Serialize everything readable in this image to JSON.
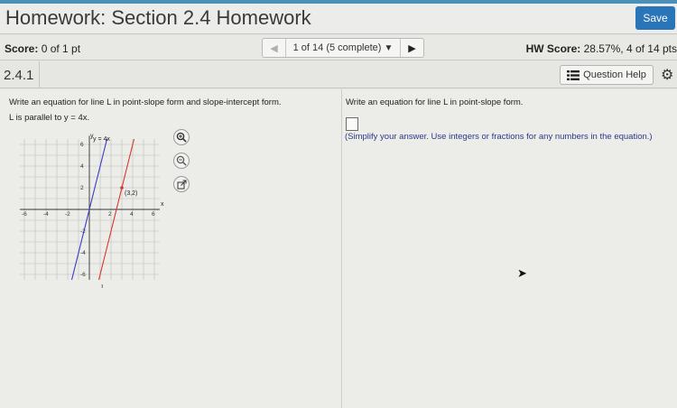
{
  "header": {
    "title": "Homework: Section 2.4 Homework",
    "save_label": "Save"
  },
  "score_bar": {
    "score_label": "Score:",
    "score_value": "0 of 1 pt",
    "nav_text": "1 of 14 (5 complete)",
    "hw_score_label": "HW Score:",
    "hw_score_value": "28.57%, 4 of 14 pts"
  },
  "question_bar": {
    "number": "2.4.1",
    "help_label": "Question Help"
  },
  "question": {
    "prompt": "Write an equation for line L in point-slope form and slope-intercept form.",
    "given": "L is parallel to y = 4x.",
    "graph": {
      "blue_line_label": "y = 4x",
      "point_label": "(3,2)",
      "line_label": "L",
      "x_axis_label": "x",
      "y_axis_label": "y",
      "x_tick_labels": [
        "-6",
        "-4",
        "-2",
        "2",
        "4",
        "6"
      ],
      "y_tick_labels": [
        "6",
        "4",
        "2",
        "-2",
        "-4",
        "-6"
      ],
      "colors": {
        "blue_line": "#3a3ac8",
        "red_line": "#d8342c",
        "point": "#d8342c"
      }
    }
  },
  "answer": {
    "instruction": "Write an equation for line L in point-slope form.",
    "hint": "(Simplify your answer. Use integers or fractions for any numbers in the equation.)"
  },
  "icons": {
    "zoom_in": "zoom-in-icon",
    "zoom_out": "zoom-out-icon",
    "popout": "popout-icon",
    "help": "list-icon",
    "settings": "gear-icon"
  }
}
